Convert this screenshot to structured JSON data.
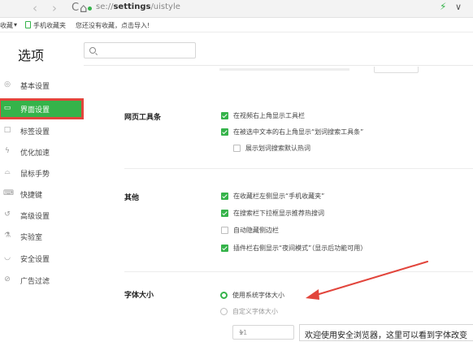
{
  "browser": {
    "back": "›",
    "forward": "›",
    "reload": "C",
    "home": "⌂",
    "url_prefix": "se://",
    "url_host": "settings",
    "url_path": "/uistyle",
    "ext1": "⚡",
    "ext2": "∨"
  },
  "bookmarks": {
    "favorites": "收藏",
    "favorites_caret": "▾",
    "mobile": "手机收藏夹",
    "empty_hint": "您还没有收藏，点击导入!"
  },
  "page": {
    "title": "选项",
    "search_placeholder": "Q"
  },
  "sidebar": {
    "items": [
      {
        "label": "基本设置",
        "icon": "gear-icon",
        "glyph": "◎"
      },
      {
        "label": "界面设置",
        "icon": "window-icon",
        "glyph": "▭"
      },
      {
        "label": "标签设置",
        "icon": "tab-icon",
        "glyph": "□"
      },
      {
        "label": "优化加速",
        "icon": "lightning-icon",
        "glyph": "ϟ"
      },
      {
        "label": "鼠标手势",
        "icon": "mouse-icon",
        "glyph": "⌓"
      },
      {
        "label": "快捷键",
        "icon": "keyboard-icon",
        "glyph": "⌨"
      },
      {
        "label": "高级设置",
        "icon": "wrench-icon",
        "glyph": "↺"
      },
      {
        "label": "实验室",
        "icon": "flask-icon",
        "glyph": "⚗"
      },
      {
        "label": "安全设置",
        "icon": "shield-icon",
        "glyph": "◡"
      },
      {
        "label": "广告过滤",
        "icon": "block-icon",
        "glyph": "⊘"
      }
    ],
    "active_index": 1
  },
  "sections": {
    "toolbar": {
      "title": "网页工具条",
      "options": [
        {
          "label": "在视频右上角显示工具栏",
          "checked": true
        },
        {
          "label": "在被选中文本的右上角显示“划词搜索工具条”",
          "checked": true
        },
        {
          "label": "展示划词搜索默认热词",
          "checked": false
        }
      ]
    },
    "other": {
      "title": "其他",
      "options": [
        {
          "label": "在收藏栏左侧显示“手机收藏夹”",
          "checked": true
        },
        {
          "label": "在搜索栏下拉框显示推荐热搜词",
          "checked": true
        },
        {
          "label": "自动隐藏侧边栏",
          "checked": false
        },
        {
          "label": "插件栏右侧显示“夜间模式”（显示后功能可用）",
          "checked": true
        }
      ]
    },
    "font": {
      "title": "字体大小",
      "options": [
        {
          "label": "使用系统字体大小",
          "selected": true
        },
        {
          "label": "自定义字体大小",
          "selected": false
        }
      ],
      "size_value": "11",
      "preview_text": "欢迎使用安全浏览器，这里可以看到字体改变"
    }
  },
  "colors": {
    "accent": "#35b34a",
    "highlight": "#e2453c"
  }
}
